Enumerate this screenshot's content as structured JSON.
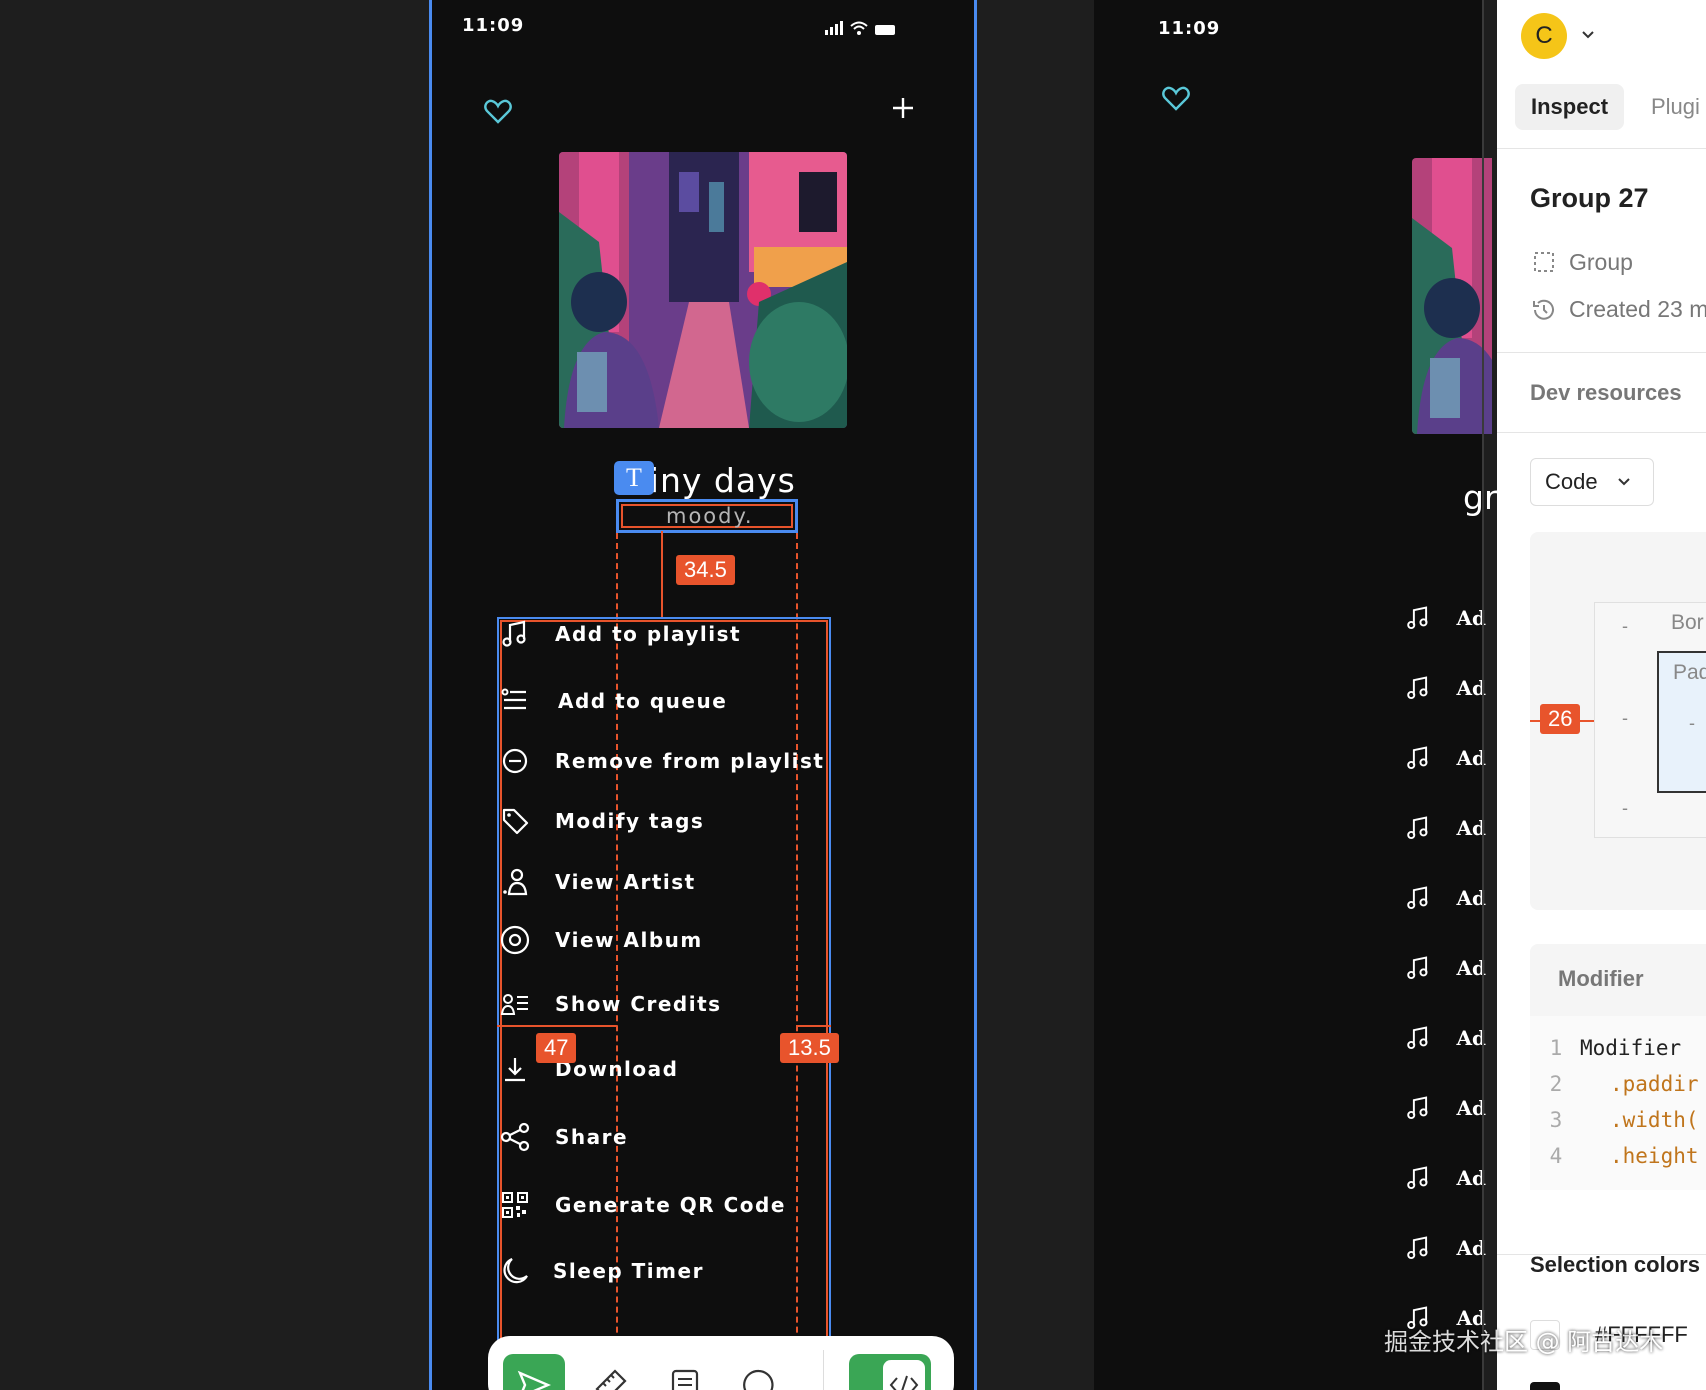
{
  "phone_left": {
    "time": "11:09",
    "song_title": "rainy days",
    "song_subtitle": "moody.",
    "menu": [
      {
        "label": "Add to playlist",
        "icon": "music-note-icon"
      },
      {
        "label": "Add to queue",
        "icon": "queue-list-icon"
      },
      {
        "label": "Remove from playlist",
        "icon": "minus-circle-icon"
      },
      {
        "label": "Modify tags",
        "icon": "tag-icon"
      },
      {
        "label": "View Artist",
        "icon": "artist-icon"
      },
      {
        "label": "View Album",
        "icon": "album-icon"
      },
      {
        "label": "Show Credits",
        "icon": "credits-icon"
      },
      {
        "label": "Download",
        "icon": "download-icon"
      },
      {
        "label": "Share",
        "icon": "share-icon"
      },
      {
        "label": "Generate QR Code",
        "icon": "qr-code-icon"
      },
      {
        "label": "Sleep Timer",
        "icon": "moon-icon"
      }
    ]
  },
  "measurements": {
    "gap_top": "34.5",
    "left_offset": "47",
    "right_offset": "13.5",
    "padding_left": "26"
  },
  "phone_right": {
    "time": "11:09",
    "title_partial": "gr",
    "row_label_partial": "Ad",
    "row_count": 11
  },
  "inspector": {
    "avatar_initial": "C",
    "tabs": [
      "Inspect",
      "Plugi"
    ],
    "selection_name": "Group 27",
    "type_label": "Group",
    "created_label": "Created 23 m",
    "dev_resources": "Dev resources",
    "code_dropdown": "Code",
    "box_border_label": "Bor",
    "box_padding_label": "Pad",
    "dash": "-",
    "modifier_header": "Modifier",
    "code_lines": [
      {
        "num": "1",
        "text": "Modifier"
      },
      {
        "num": "2",
        "text": ".paddir"
      },
      {
        "num": "3",
        "text": ".width("
      },
      {
        "num": "4",
        "text": ".height"
      }
    ],
    "selection_colors": "Selection colors",
    "color_value": "#FFFFFF"
  },
  "watermark": "掘金技术社区 @ 阿古达木",
  "colors": {
    "frame_selection": "#4a8bf0",
    "measure": "#e8542c",
    "accent_heart": "#5ac8d8",
    "toolbar_green": "#3aa655"
  }
}
